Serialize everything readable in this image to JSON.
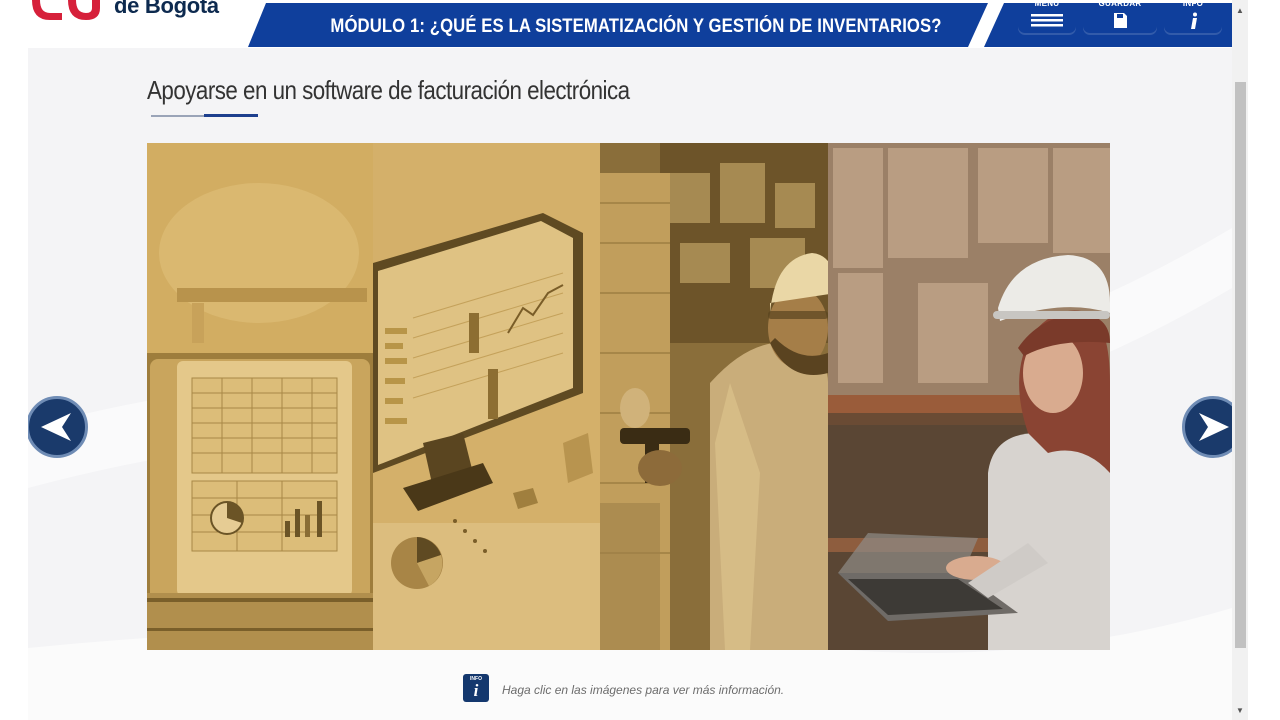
{
  "header": {
    "logo_text": "de Bogotá",
    "module_title": "MÓDULO 1: ¿QUÉ ES LA SISTEMATIZACIÓN Y GESTIÓN DE INVENTARIOS?",
    "nav": [
      {
        "label": "MENU",
        "icon": "hamburger-icon"
      },
      {
        "label": "GUARDAR",
        "icon": "save-icon"
      },
      {
        "label": "INFO",
        "icon": "info-icon"
      }
    ]
  },
  "slide": {
    "title": "Apoyarse en un software de facturación electrónica",
    "panels": [
      {
        "name": "panel-tablet-spreadsheet",
        "depicts": "tablet with spreadsheet and charts"
      },
      {
        "name": "panel-monitor-analytics",
        "depicts": "monitor with analytics dashboard"
      },
      {
        "name": "panel-worker-scanner",
        "depicts": "warehouse worker scanning boxes"
      },
      {
        "name": "panel-woman-laptop",
        "depicts": "woman in hard hat using laptop"
      }
    ],
    "hint_text": "Haga clic en las imágenes para ver más información.",
    "info_icon_small": "INFO",
    "info_icon_big": "i"
  },
  "colors": {
    "header_blue": "#0f3f9c",
    "logo_red": "#d6203a",
    "sepia": "#c9a45c",
    "arrow_blue": "#1a3a6b"
  }
}
